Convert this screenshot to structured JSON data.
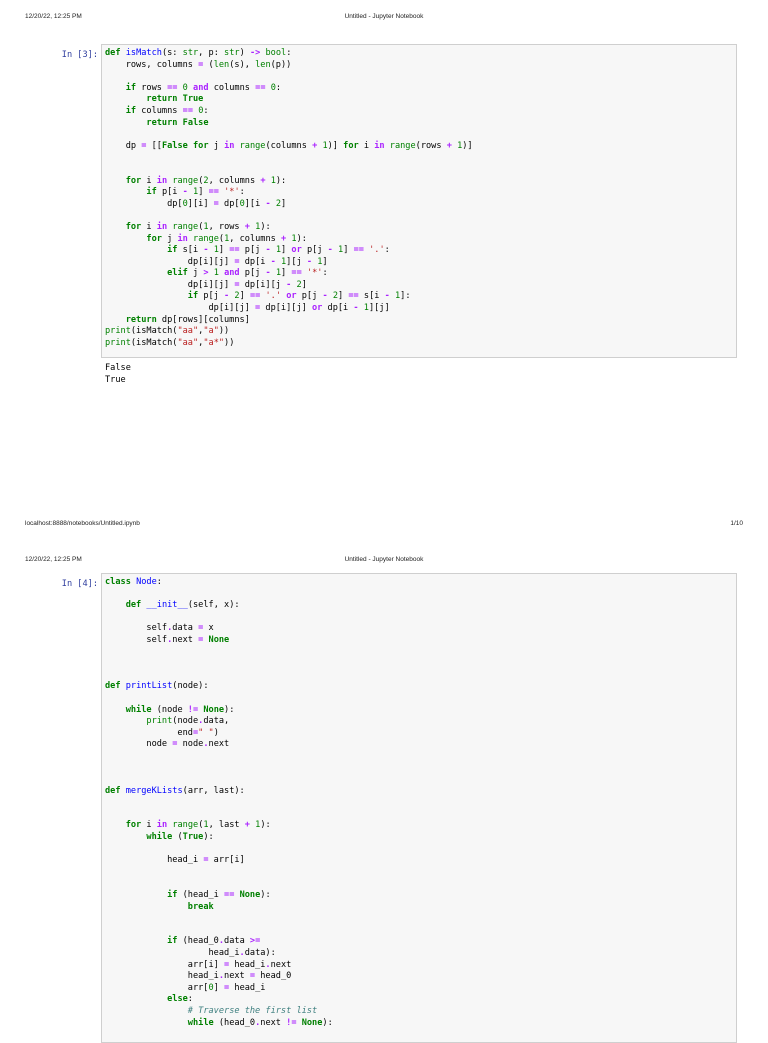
{
  "pages": [
    {
      "date": "12/20/22, 12:25 PM",
      "title": "Untitled - Jupyter Notebook",
      "cell_prompt": "In [3]:",
      "output_lines": [
        "False",
        "True"
      ],
      "footer_url": "localhost:8888/notebooks/Untitled.ipynb",
      "footer_page": "1/10"
    },
    {
      "date": "12/20/22, 12:25 PM",
      "title": "Untitled - Jupyter Notebook",
      "cell_prompt": "In [4]:"
    }
  ]
}
